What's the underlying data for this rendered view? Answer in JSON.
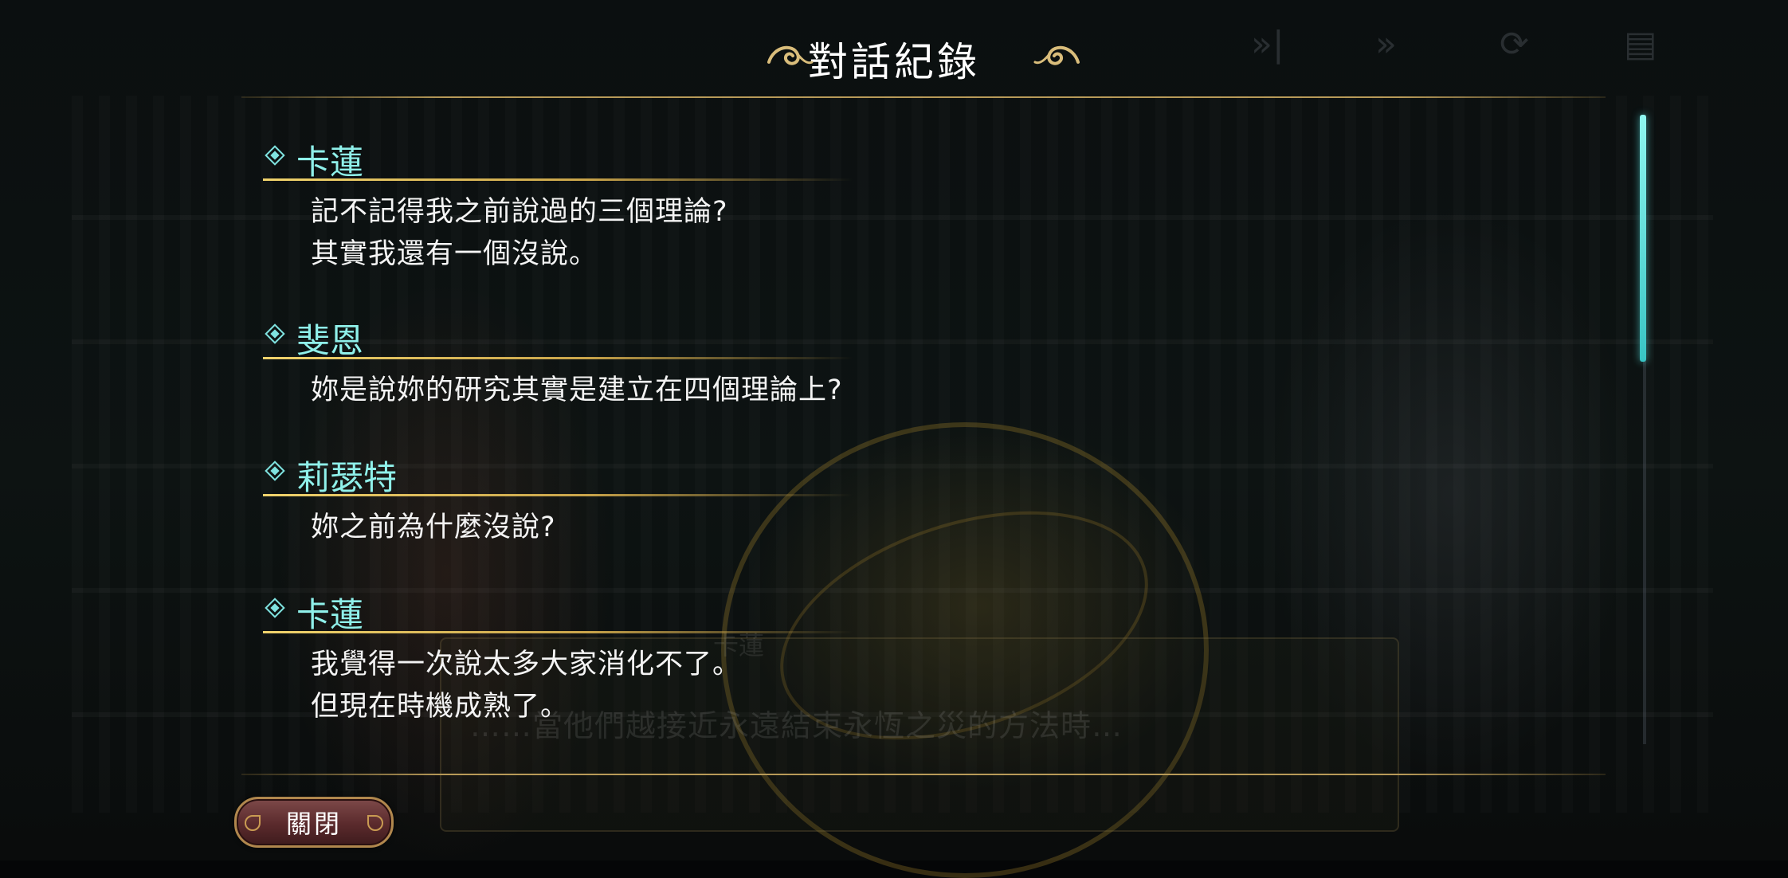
{
  "header": {
    "title": "對話紀錄"
  },
  "log": [
    {
      "speaker": "卡蓮",
      "lines": [
        "記不記得我之前說過的三個理論?",
        "其實我還有一個沒說。"
      ]
    },
    {
      "speaker": "斐恩",
      "lines": [
        "妳是說妳的研究其實是建立在四個理論上?"
      ]
    },
    {
      "speaker": "莉瑟特",
      "lines": [
        "妳之前為什麼沒說?"
      ]
    },
    {
      "speaker": "卡蓮",
      "lines": [
        "我覺得一次說太多大家消化不了。",
        "但現在時機成熟了。"
      ]
    }
  ],
  "background": {
    "dialog_speaker": "卡蓮",
    "dialog_text": "……當他們越接近永遠結束永恆之災的方法時…"
  },
  "footer": {
    "close_label": "關閉"
  },
  "colors": {
    "accent_cyan": "#8ff0ea",
    "gold_rule": "#b89a58",
    "button_red": "#5a2a2c"
  },
  "icons": [
    "skip-icon",
    "fast-forward-icon",
    "auto-icon",
    "log-icon",
    "swirl-ornament-icon",
    "diamond-bullet-icon"
  ]
}
